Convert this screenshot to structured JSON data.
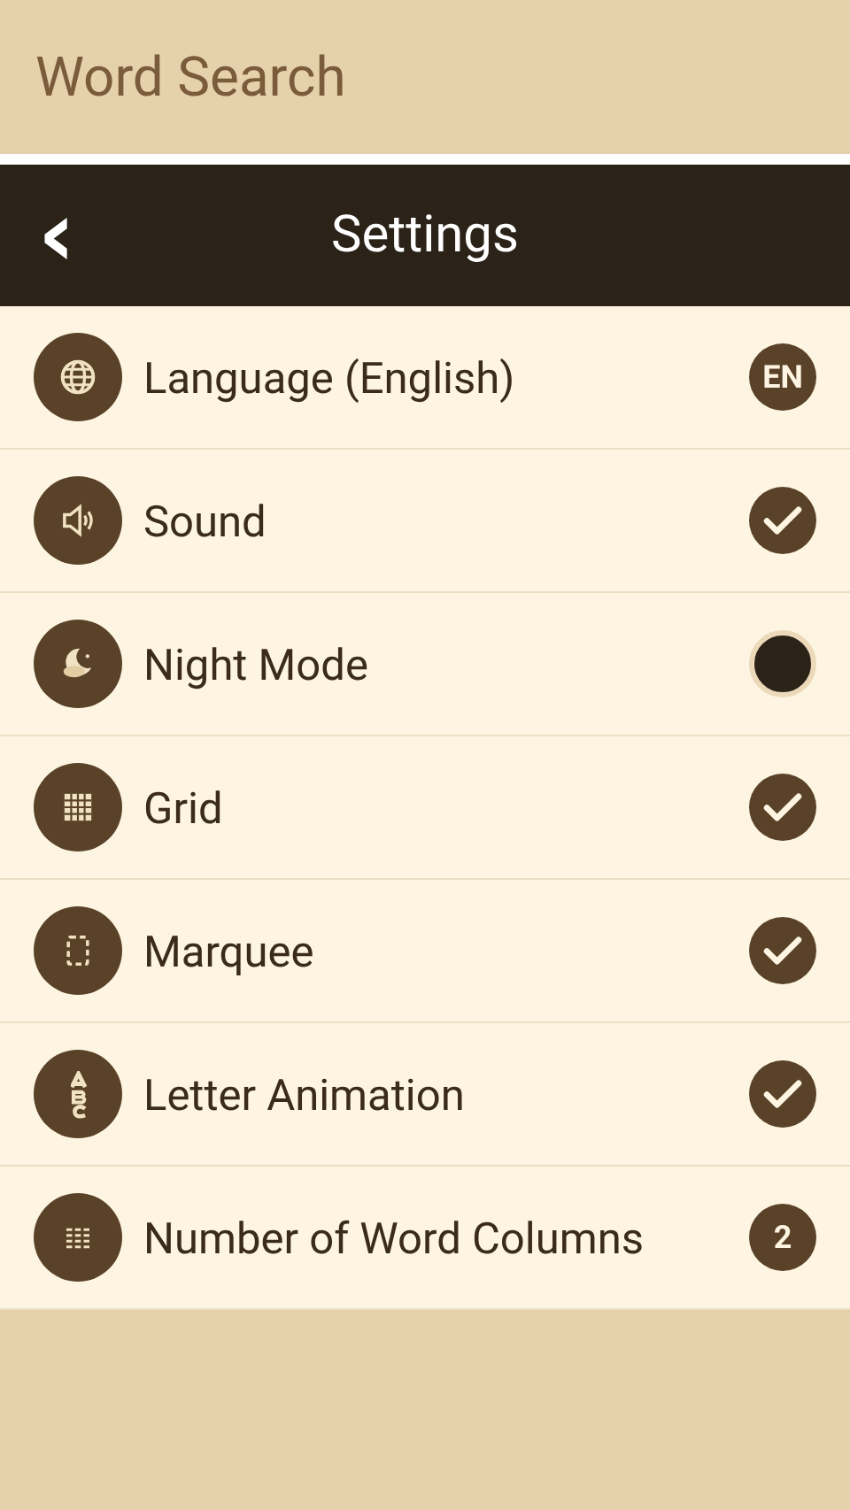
{
  "app_bar": {
    "title": "Word Search"
  },
  "header": {
    "back": "‹",
    "title": "Settings"
  },
  "settings": [
    {
      "label": "Language (English)",
      "kind": "badge",
      "badge": "EN"
    },
    {
      "label": "Sound",
      "kind": "toggle",
      "checked": true
    },
    {
      "label": "Night Mode",
      "kind": "toggle",
      "checked": false
    },
    {
      "label": "Grid",
      "kind": "toggle",
      "checked": true
    },
    {
      "label": "Marquee",
      "kind": "toggle",
      "checked": true
    },
    {
      "label": "Letter Animation",
      "kind": "toggle",
      "checked": true
    },
    {
      "label": "Number of Word Columns",
      "kind": "badge",
      "badge": "2"
    }
  ]
}
